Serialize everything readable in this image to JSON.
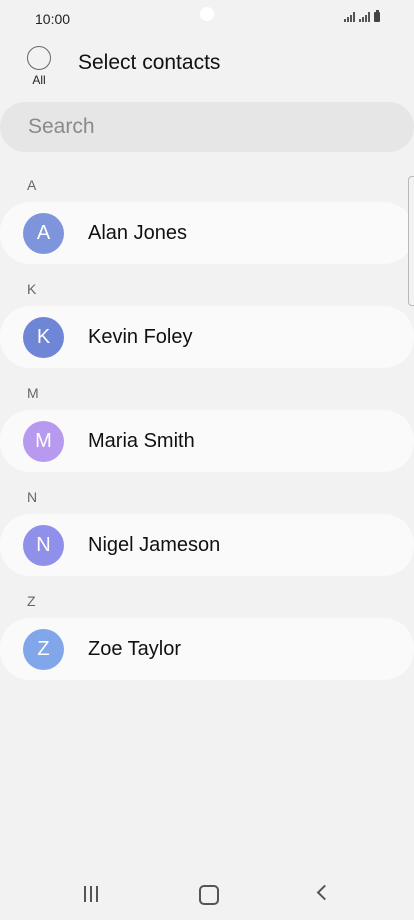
{
  "status_bar": {
    "time": "10:00",
    "icons": [
      "signal-icon",
      "signal-icon",
      "battery-icon"
    ]
  },
  "header": {
    "select_all_label": "All",
    "title": "Select contacts"
  },
  "search": {
    "placeholder": "Search",
    "value": ""
  },
  "contacts": {
    "sections": [
      {
        "letter": "A",
        "name": "Alan Jones",
        "initial": "A",
        "avatar_color": "#7f95db"
      },
      {
        "letter": "K",
        "name": "Kevin Foley",
        "initial": "K",
        "avatar_color": "#6f86d6"
      },
      {
        "letter": "M",
        "name": "Maria Smith",
        "initial": "M",
        "avatar_color": "#b79af0"
      },
      {
        "letter": "N",
        "name": "Nigel Jameson",
        "initial": "N",
        "avatar_color": "#8e90ea"
      },
      {
        "letter": "Z",
        "name": "Zoe Taylor",
        "initial": "Z",
        "avatar_color": "#82a6ea"
      }
    ]
  },
  "nav_bar": {
    "icons": [
      "recents-icon",
      "home-icon",
      "back-icon"
    ]
  }
}
